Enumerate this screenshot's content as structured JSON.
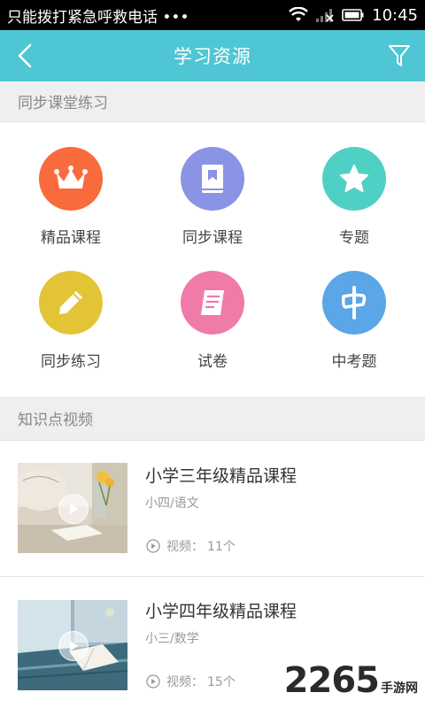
{
  "status_bar": {
    "notification": "只能拨打紧急呼救电话 •••",
    "time": "10:45"
  },
  "header": {
    "title": "学习资源"
  },
  "sections": {
    "sync_practice": "同步课堂练习",
    "knowledge_video": "知识点视频"
  },
  "grid": [
    {
      "label": "精品课程",
      "icon": "crown-icon",
      "color": "#f96a3c"
    },
    {
      "label": "同步课程",
      "icon": "book-icon",
      "color": "#8a93e4"
    },
    {
      "label": "专题",
      "icon": "star-icon",
      "color": "#4fd0c4"
    },
    {
      "label": "同步练习",
      "icon": "pencil-icon",
      "color": "#e3c437"
    },
    {
      "label": "试卷",
      "icon": "paper-icon",
      "color": "#f07aa8"
    },
    {
      "label": "中考题",
      "icon": "zhong-icon",
      "color": "#5aa6e6"
    }
  ],
  "videos": [
    {
      "title": "小学三年级精品课程",
      "subtitle": "小四/语文",
      "meta_label": "视频：",
      "count": "11个"
    },
    {
      "title": "小学四年级精品课程",
      "subtitle": "小三/数学",
      "meta_label": "视频：",
      "count": "15个"
    }
  ],
  "watermark": {
    "number": "2265",
    "text": "手游网"
  }
}
